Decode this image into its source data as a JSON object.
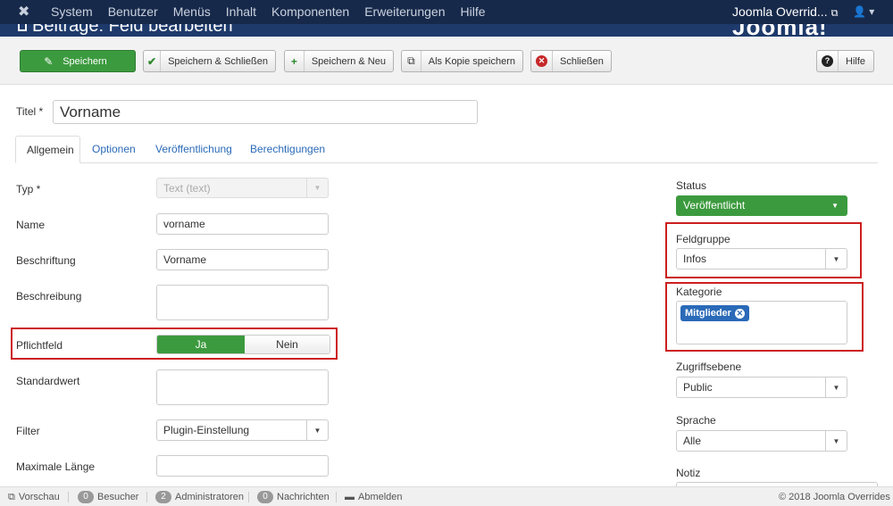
{
  "navbar": {
    "menu": [
      "System",
      "Benutzer",
      "Menüs",
      "Inhalt",
      "Komponenten",
      "Erweiterungen",
      "Hilfe"
    ],
    "site_name": "Joomla Overrid...",
    "user_icon": "user-icon"
  },
  "page": {
    "title": "Beiträge: Feld bearbeiten",
    "brand": "Joomla!"
  },
  "toolbar": {
    "save": "Speichern",
    "save_close": "Speichern & Schließen",
    "save_new": "Speichern & Neu",
    "save_copy": "Als Kopie speichern",
    "close": "Schließen",
    "help": "Hilfe"
  },
  "title_field": {
    "label": "Titel *",
    "value": "Vorname"
  },
  "tabs": [
    "Allgemein",
    "Optionen",
    "Veröffentlichung",
    "Berechtigungen"
  ],
  "form": {
    "type": {
      "label": "Typ *",
      "value": "Text (text)"
    },
    "name": {
      "label": "Name",
      "value": "vorname"
    },
    "caption": {
      "label": "Beschriftung",
      "value": "Vorname"
    },
    "description": {
      "label": "Beschreibung",
      "value": ""
    },
    "required": {
      "label": "Pflichtfeld",
      "yes": "Ja",
      "no": "Nein",
      "selected": "Ja"
    },
    "default": {
      "label": "Standardwert",
      "value": ""
    },
    "filter": {
      "label": "Filter",
      "value": "Plugin-Einstellung"
    },
    "maxlength": {
      "label": "Maximale Länge",
      "value": ""
    }
  },
  "sidebar": {
    "status": {
      "label": "Status",
      "value": "Veröffentlicht"
    },
    "fieldgroup": {
      "label": "Feldgruppe",
      "value": "Infos"
    },
    "category": {
      "label": "Kategorie",
      "tag": "Mitglieder"
    },
    "access": {
      "label": "Zugriffsebene",
      "value": "Public"
    },
    "language": {
      "label": "Sprache",
      "value": "Alle"
    },
    "note": {
      "label": "Notiz"
    }
  },
  "footer": {
    "preview": "Vorschau",
    "visitors_count": "0",
    "visitors": "Besucher",
    "admins_count": "2",
    "admins": "Administratoren",
    "messages_count": "0",
    "messages": "Nachrichten",
    "logout": "Abmelden",
    "copyright": "© 2018 Joomla Overrides"
  },
  "colors": {
    "navbar": "#17294a",
    "success": "#3c9a3e",
    "link": "#2a6ab8",
    "highlight": "#cc1f1f"
  }
}
